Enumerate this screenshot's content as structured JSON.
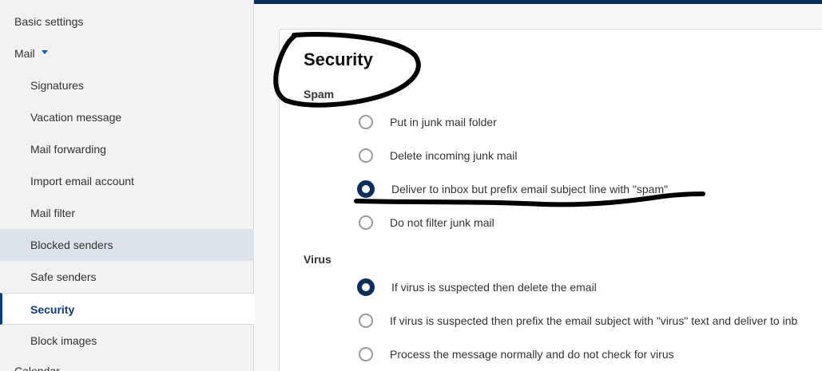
{
  "sidebar": {
    "items": [
      {
        "label": "Basic settings"
      },
      {
        "label": "Mail"
      },
      {
        "label": "Signatures"
      },
      {
        "label": "Vacation message"
      },
      {
        "label": "Mail forwarding"
      },
      {
        "label": "Import email account"
      },
      {
        "label": "Mail filter"
      },
      {
        "label": "Blocked senders"
      },
      {
        "label": "Safe senders"
      },
      {
        "label": "Security"
      },
      {
        "label": "Block images"
      },
      {
        "label": "Calendar"
      }
    ]
  },
  "page": {
    "title": "Security"
  },
  "spam": {
    "heading": "Spam",
    "options": [
      {
        "label": "Put in junk mail folder",
        "checked": false
      },
      {
        "label": "Delete incoming junk mail",
        "checked": false
      },
      {
        "label": "Deliver to inbox but prefix email subject line with \"spam\"",
        "checked": true
      },
      {
        "label": "Do not filter junk mail",
        "checked": false
      }
    ]
  },
  "virus": {
    "heading": "Virus",
    "options": [
      {
        "label": "If virus is suspected then delete the email",
        "checked": true
      },
      {
        "label": "If virus is suspected then prefix the email subject with \"virus\" text and deliver to inb",
        "checked": false
      },
      {
        "label": "Process the message normally and do not check for virus",
        "checked": false
      }
    ]
  },
  "colors": {
    "accent": "#0b2e5c",
    "active_nav": "#0b3a78",
    "sidebar_bg": "#f2f2f2",
    "hover_bg": "#dde3ea"
  }
}
